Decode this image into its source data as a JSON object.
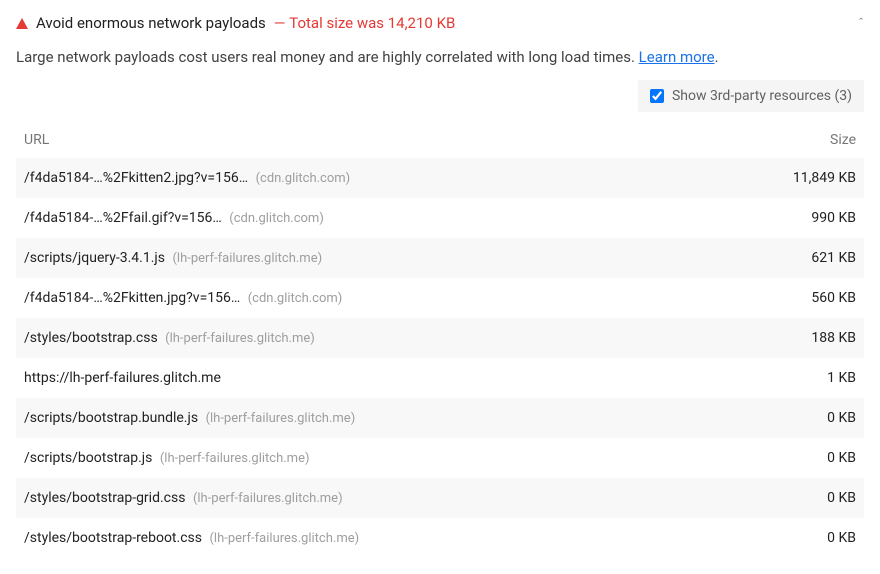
{
  "audit": {
    "title": "Avoid enormous network payloads",
    "status_prefix": "—",
    "status": "Total size was 14,210 KB",
    "description": "Large network payloads cost users real money and are highly correlated with long load times.",
    "learn_more": "Learn more",
    "chevron": "ˆ"
  },
  "third_party": {
    "label": "Show 3rd-party resources (3)",
    "checked": true
  },
  "table": {
    "columns": {
      "url": "URL",
      "size": "Size"
    },
    "rows": [
      {
        "path": "/f4da5184-…%2Fkitten2.jpg?v=156…",
        "origin": "(cdn.glitch.com)",
        "size": "11,849 KB"
      },
      {
        "path": "/f4da5184-…%2Ffail.gif?v=156…",
        "origin": "(cdn.glitch.com)",
        "size": "990 KB"
      },
      {
        "path": "/scripts/jquery-3.4.1.js",
        "origin": "(lh-perf-failures.glitch.me)",
        "size": "621 KB"
      },
      {
        "path": "/f4da5184-…%2Fkitten.jpg?v=156…",
        "origin": "(cdn.glitch.com)",
        "size": "560 KB"
      },
      {
        "path": "/styles/bootstrap.css",
        "origin": "(lh-perf-failures.glitch.me)",
        "size": "188 KB"
      },
      {
        "path": "https://lh-perf-failures.glitch.me",
        "origin": "",
        "size": "1 KB"
      },
      {
        "path": "/scripts/bootstrap.bundle.js",
        "origin": "(lh-perf-failures.glitch.me)",
        "size": "0 KB"
      },
      {
        "path": "/scripts/bootstrap.js",
        "origin": "(lh-perf-failures.glitch.me)",
        "size": "0 KB"
      },
      {
        "path": "/styles/bootstrap-grid.css",
        "origin": "(lh-perf-failures.glitch.me)",
        "size": "0 KB"
      },
      {
        "path": "/styles/bootstrap-reboot.css",
        "origin": "(lh-perf-failures.glitch.me)",
        "size": "0 KB"
      }
    ]
  }
}
